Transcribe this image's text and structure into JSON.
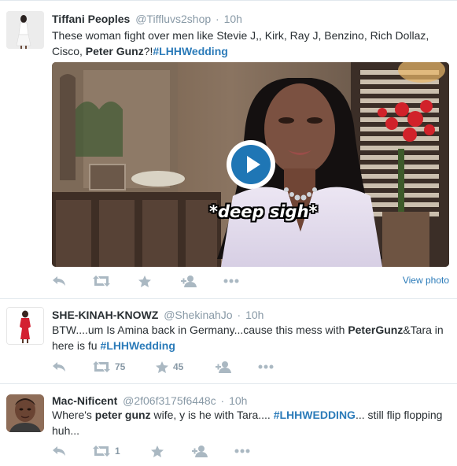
{
  "tweets": [
    {
      "fullname": "Tiffani Peoples",
      "username": "@Tiffluvs2shop",
      "dot": "·",
      "time": "10h",
      "text_before": "These woman fight over men like  Stevie J,, Kirk, Ray J, Benzino, Rich Dollaz, Cisco, ",
      "bold_text": "Peter Gunz",
      "text_mid": "?!",
      "hashtag": "#LHHWedding",
      "media_caption": "*deep sigh*",
      "view_link": "View photo",
      "retweet_count": "",
      "favorite_count": ""
    },
    {
      "fullname": "SHE-KINAH-KNOWZ",
      "username": "@ShekinahJo",
      "dot": "·",
      "time": "10h",
      "text_before": "BTW....um Is Amina back in Germany...cause this mess with ",
      "bold_text": "PeterGunz",
      "text_mid": "&Tara in here is fu ",
      "hashtag": "#LHHWedding",
      "retweet_count": "75",
      "favorite_count": "45"
    },
    {
      "fullname": "Mac-Nificent",
      "username": "@2f06f3175f6448c",
      "dot": "·",
      "time": "10h",
      "text_before": "Where's ",
      "bold_text": "peter gunz",
      "text_mid": " wife, y is he with Tara.... ",
      "hashtag": "#LHHWEDDING",
      "text_after": "... still flip flopping huh...",
      "retweet_count": "1",
      "favorite_count": ""
    }
  ],
  "icons": {
    "reply": "reply-icon",
    "retweet": "retweet-icon",
    "favorite": "star-icon",
    "follow": "follow-icon",
    "more": "more-icon",
    "play": "play-icon"
  },
  "colors": {
    "link": "#2b7bb9",
    "muted": "#8899a6",
    "text": "#292f33",
    "play": "#1f76b5"
  }
}
